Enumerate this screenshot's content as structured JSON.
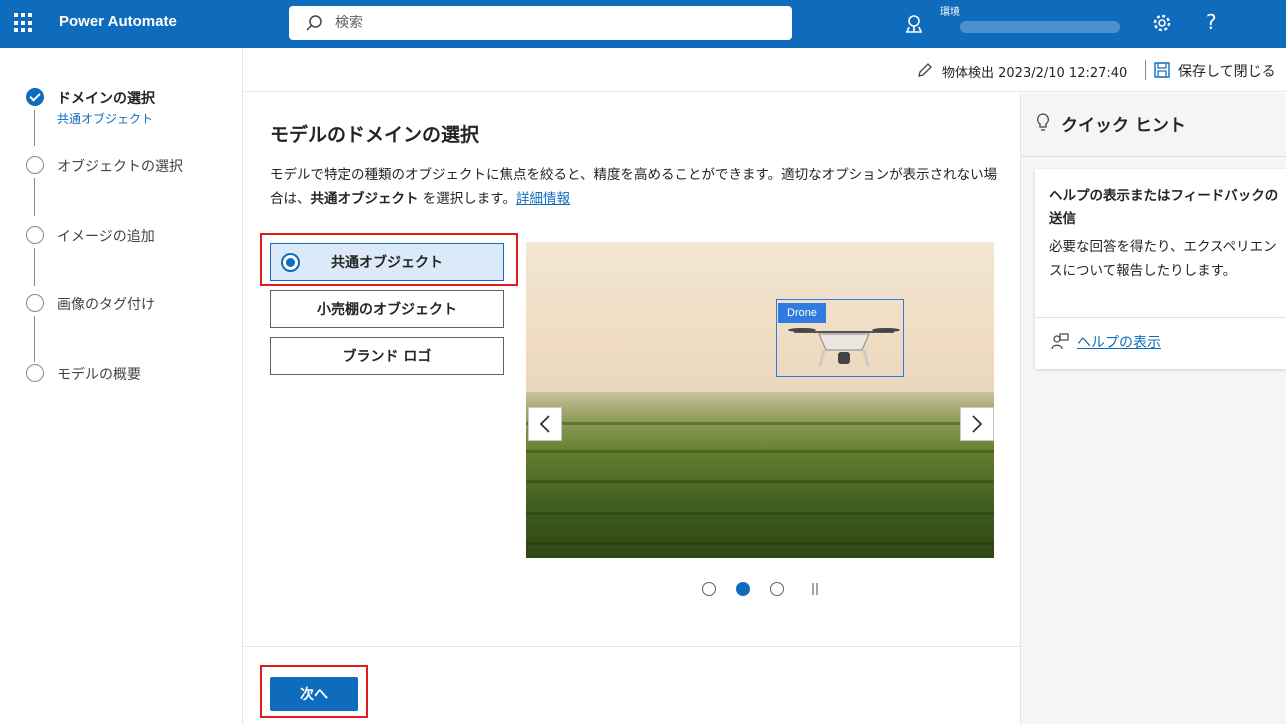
{
  "header": {
    "app_title": "Power Automate",
    "search_placeholder": "検索",
    "environment_label": "環境"
  },
  "steps": [
    {
      "label": "ドメインの選択",
      "sublabel": "共通オブジェクト",
      "state": "done"
    },
    {
      "label": "オブジェクトの選択",
      "state": "pending"
    },
    {
      "label": "イメージの追加",
      "state": "pending"
    },
    {
      "label": "画像のタグ付け",
      "state": "pending"
    },
    {
      "label": "モデルの概要",
      "state": "pending"
    }
  ],
  "command_bar": {
    "draft_label": "物体検出 2023/2/10 12:27:40",
    "save_label": "保存して閉じる"
  },
  "main": {
    "title": "モデルのドメインの選択",
    "desc_part1": "モデルで特定の種類のオブジェクトに焦点を絞ると、精度を高めることができます。適切なオプションが表示されない場合は、",
    "desc_bold": "共通オブジェクト",
    "desc_part2": " を選択します。",
    "desc_link": "詳細情報",
    "options": [
      {
        "label": "共通オブジェクト",
        "selected": true
      },
      {
        "label": "小売棚のオブジェクト",
        "selected": false
      },
      {
        "label": "ブランド ロゴ",
        "selected": false
      }
    ],
    "carousel": {
      "image_tag": "Drone",
      "current_slide": 2,
      "total_slides": 3
    }
  },
  "footer": {
    "next_label": "次へ"
  },
  "tips": {
    "title": "クイック ヒント",
    "card_title": "ヘルプの表示またはフィードバックの送信",
    "card_body": "必要な回答を得たり、エクスペリエンスについて報告したりします。",
    "help_link": "ヘルプの表示"
  },
  "colors": {
    "brand": "#0f6cbd",
    "highlight": "#e41b1b",
    "selected_bg": "#dbe9f8"
  }
}
